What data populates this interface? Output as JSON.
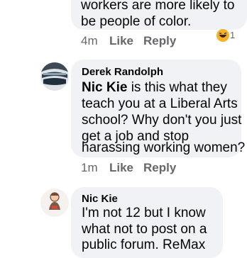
{
  "comment_prev": {
    "text_line1": "workers are more likely to",
    "text_line2": "be people of color.",
    "time": "4m",
    "like": "Like",
    "reply": "Reply",
    "reaction_count": "1"
  },
  "comment_derek": {
    "author": "Derek Randolph",
    "mention": "Nic Kie",
    "line1_rest": " is this what they",
    "line2": "teach you at a Liberal Arts",
    "line3": "school? Why don't you just",
    "line4": "get a job and stop",
    "line5": "harassing working women?",
    "time": "1m",
    "like": "Like",
    "reply": "Reply"
  },
  "comment_nic": {
    "author": "Nic Kie",
    "line1": "I'm not 12 but I know",
    "line2": "what not to post on a",
    "line3": "public forum. ReMax"
  },
  "colors": {
    "bubble": "#f0f2f5",
    "meta": "#65676b",
    "text": "#050505"
  }
}
